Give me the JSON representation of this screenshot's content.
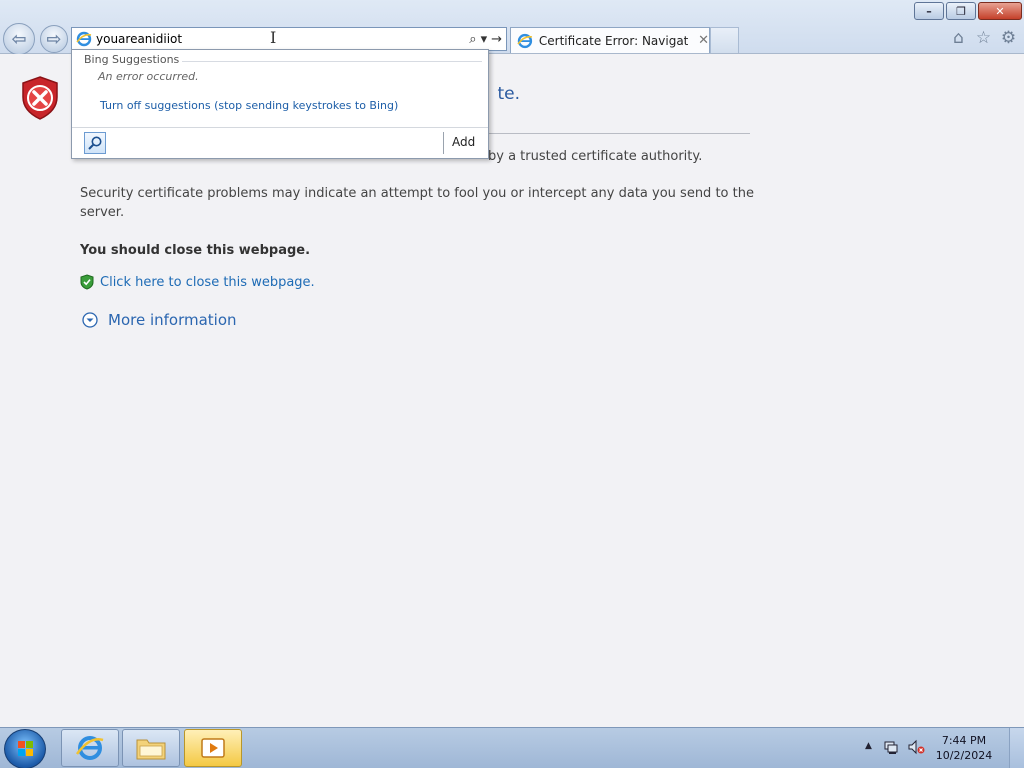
{
  "window": {
    "controls": {
      "minimize": "–",
      "restore": "❐",
      "close": "✕"
    }
  },
  "nav": {
    "back_glyph": "⇦",
    "forward_glyph": "⇨"
  },
  "address": {
    "value": "youareanidiiot",
    "search_glyph": "⌕",
    "dropdown_glyph": "▾",
    "go_glyph": "→"
  },
  "tab": {
    "label": "Certificate Error: Navigatio...",
    "close": "✕"
  },
  "toolbar": {
    "home": "⌂",
    "favorites": "☆",
    "tools": "⚙"
  },
  "suggestions": {
    "header": "Bing Suggestions",
    "error": "An error occurred.",
    "turn_off": "Turn off suggestions (stop sending keystrokes to Bing)",
    "add_label": "Add"
  },
  "page": {
    "heading_partial": "te.",
    "para1_partial": "by a trusted certificate authority.",
    "para2": "Security certificate problems may indicate an attempt to fool you or intercept any data you send to the server.",
    "close_advice": "You should close this webpage.",
    "close_link": "Click here to close this webpage.",
    "more_info": "More information"
  },
  "taskbar": {
    "clock_time": "7:44 PM",
    "clock_date": "10/2/2024"
  },
  "colors": {
    "link": "#1e6bb5",
    "heading": "#2a5aa0",
    "error_red": "#c8252a"
  }
}
